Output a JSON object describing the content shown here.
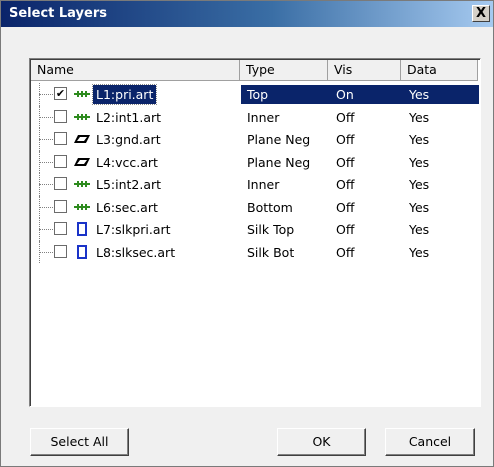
{
  "window": {
    "title": "Select Layers",
    "close_label": "X"
  },
  "columns": {
    "name": "Name",
    "type": "Type",
    "vis": "Vis",
    "data": "Data"
  },
  "layers": [
    {
      "name": "L1:pri.art",
      "type": "Top",
      "vis": "On",
      "data": "Yes",
      "checked": true,
      "icon": "trace-layer-icon",
      "icon_color": "#2e8b1e"
    },
    {
      "name": "L2:int1.art",
      "type": "Inner",
      "vis": "Off",
      "data": "Yes",
      "checked": false,
      "icon": "trace-layer-icon",
      "icon_color": "#2e8b1e"
    },
    {
      "name": "L3:gnd.art",
      "type": "Plane Neg",
      "vis": "Off",
      "data": "Yes",
      "checked": false,
      "icon": "plane-layer-icon",
      "icon_color": "#000000"
    },
    {
      "name": "L4:vcc.art",
      "type": "Plane Neg",
      "vis": "Off",
      "data": "Yes",
      "checked": false,
      "icon": "plane-layer-icon",
      "icon_color": "#000000"
    },
    {
      "name": "L5:int2.art",
      "type": "Inner",
      "vis": "Off",
      "data": "Yes",
      "checked": false,
      "icon": "trace-layer-icon",
      "icon_color": "#2e8b1e"
    },
    {
      "name": "L6:sec.art",
      "type": "Bottom",
      "vis": "Off",
      "data": "Yes",
      "checked": false,
      "icon": "trace-layer-icon",
      "icon_color": "#2e8b1e"
    },
    {
      "name": "L7:slkpri.art",
      "type": "Silk Top",
      "vis": "Off",
      "data": "Yes",
      "checked": false,
      "icon": "silk-layer-icon",
      "icon_color": "#1a33c8"
    },
    {
      "name": "L8:slksec.art",
      "type": "Silk Bot",
      "vis": "Off",
      "data": "Yes",
      "checked": false,
      "icon": "silk-layer-icon",
      "icon_color": "#1a33c8"
    }
  ],
  "selected_row": 0,
  "buttons": {
    "select_all": "Select All",
    "ok": "OK",
    "cancel": "Cancel"
  }
}
